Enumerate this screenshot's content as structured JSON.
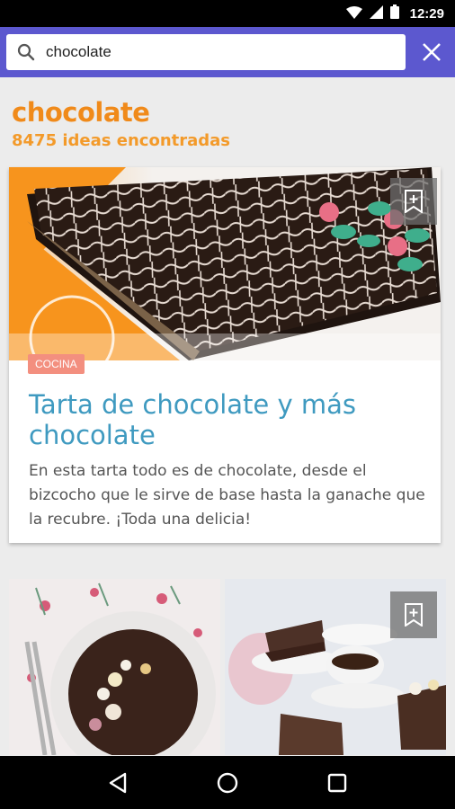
{
  "status_bar": {
    "time": "12:29",
    "icons": [
      "wifi-icon",
      "signal-icon",
      "battery-icon"
    ]
  },
  "search": {
    "value": "chocolate",
    "icon": "search-icon",
    "close_icon": "close-icon"
  },
  "results": {
    "title": "chocolate",
    "count_text": "8475 ideas encontradas"
  },
  "card": {
    "tag": "COCINA",
    "title": "Tarta de chocolate y más chocolate",
    "description": "En esta tarta todo es de chocolate, desde el bizcocho que le sirve de base hasta la ganache que la recubre. ¡Toda una delicia!",
    "bookmark_icon": "bookmark-add-icon"
  },
  "tiles": [
    {
      "name": "chocolate-cake-photo"
    },
    {
      "name": "cheesecake-slices-photo",
      "bookmark_icon": "bookmark-add-icon"
    }
  ],
  "nav_bar": {
    "icons": [
      "back-icon",
      "home-icon",
      "recents-icon"
    ]
  },
  "colors": {
    "accent": "#5c58cf",
    "orange": "#f08a1a",
    "title_blue": "#3f9ac0",
    "tag": "#f38f7f"
  }
}
